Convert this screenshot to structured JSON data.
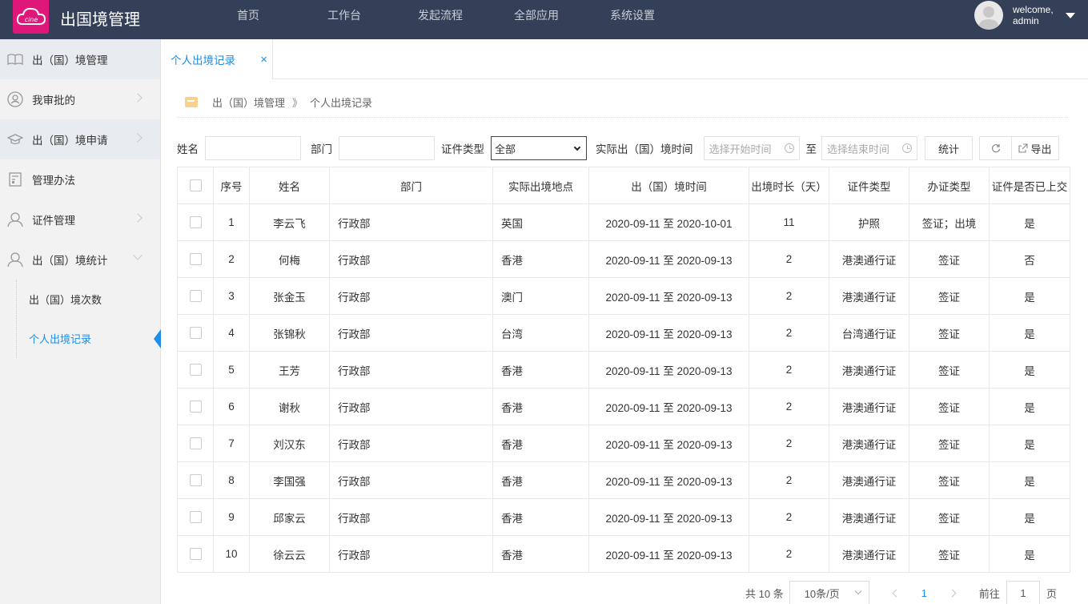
{
  "header": {
    "app_title": "出国境管理",
    "logo_text": "Ecine",
    "nav": [
      "首页",
      "工作台",
      "发起流程",
      "全部应用",
      "系统设置"
    ],
    "welcome_line1": "welcome,",
    "welcome_line2": "admin"
  },
  "sidebar": {
    "items": [
      {
        "label": "出（国）境管理",
        "icon": "book-icon"
      },
      {
        "label": "我审批的",
        "icon": "user-circle-icon"
      },
      {
        "label": "出（国）境申请",
        "icon": "graduation-cap-icon"
      },
      {
        "label": "管理办法",
        "icon": "document-icon"
      },
      {
        "label": "证件管理",
        "icon": "person-icon"
      },
      {
        "label": "出（国）境统计",
        "icon": "person-icon"
      }
    ],
    "sub_items": [
      "出（国）境次数",
      "个人出境记录"
    ]
  },
  "tabs": {
    "active_label": "个人出境记录",
    "close": "×"
  },
  "breadcrumb": {
    "root": "出（国）境管理",
    "sep": "》",
    "current": "个人出境记录"
  },
  "filters": {
    "name_label": "姓名",
    "name_value": "",
    "dept_label": "部门",
    "dept_value": "",
    "cert_label": "证件类型",
    "cert_value": "全部",
    "time_label": "实际出（国）境时间",
    "start_placeholder": "选择开始时间",
    "to_label": "至",
    "end_placeholder": "选择结束时间",
    "stat_button": "统计",
    "export_button": "导出"
  },
  "table": {
    "headers": [
      "序号",
      "姓名",
      "部门",
      "实际出境地点",
      "出（国）境时间",
      "出境时长（天）",
      "证件类型",
      "办证类型",
      "证件是否已上交"
    ],
    "rows": [
      [
        "1",
        "李云飞",
        "行政部",
        "英国",
        "2020-09-11 至 2020-10-01",
        "11",
        "护照",
        "签证；出境",
        "是"
      ],
      [
        "2",
        "何梅",
        "行政部",
        "香港",
        "2020-09-11 至 2020-09-13",
        "2",
        "港澳通行证",
        "签证",
        "否"
      ],
      [
        "3",
        "张金玉",
        "行政部",
        "澳门",
        "2020-09-11 至 2020-09-13",
        "2",
        "港澳通行证",
        "签证",
        "是"
      ],
      [
        "4",
        "张锦秋",
        "行政部",
        "台湾",
        "2020-09-11 至 2020-09-13",
        "2",
        "台湾通行证",
        "签证",
        "是"
      ],
      [
        "5",
        "王芳",
        "行政部",
        "香港",
        "2020-09-11 至 2020-09-13",
        "2",
        "港澳通行证",
        "签证",
        "是"
      ],
      [
        "6",
        "谢秋",
        "行政部",
        "香港",
        "2020-09-11 至 2020-09-13",
        "2",
        "港澳通行证",
        "签证",
        "是"
      ],
      [
        "7",
        "刘汉东",
        "行政部",
        "香港",
        "2020-09-11 至 2020-09-13",
        "2",
        "港澳通行证",
        "签证",
        "是"
      ],
      [
        "8",
        "李国强",
        "行政部",
        "香港",
        "2020-09-11 至 2020-09-13",
        "2",
        "港澳通行证",
        "签证",
        "是"
      ],
      [
        "9",
        "邱家云",
        "行政部",
        "香港",
        "2020-09-11 至 2020-09-13",
        "2",
        "港澳通行证",
        "签证",
        "是"
      ],
      [
        "10",
        "徐云云",
        "行政部",
        "香港",
        "2020-09-11 至 2020-09-13",
        "2",
        "港澳通行证",
        "签证",
        "是"
      ]
    ]
  },
  "pagination": {
    "total": "共 10 条",
    "page_size": "10条/页",
    "current_page": "1",
    "goto_label": "前往",
    "goto_value": "1",
    "page_suffix": "页"
  },
  "colors": {
    "topbar": "#344058",
    "accent": "#1e8ee8",
    "logo": "#e0177a"
  }
}
